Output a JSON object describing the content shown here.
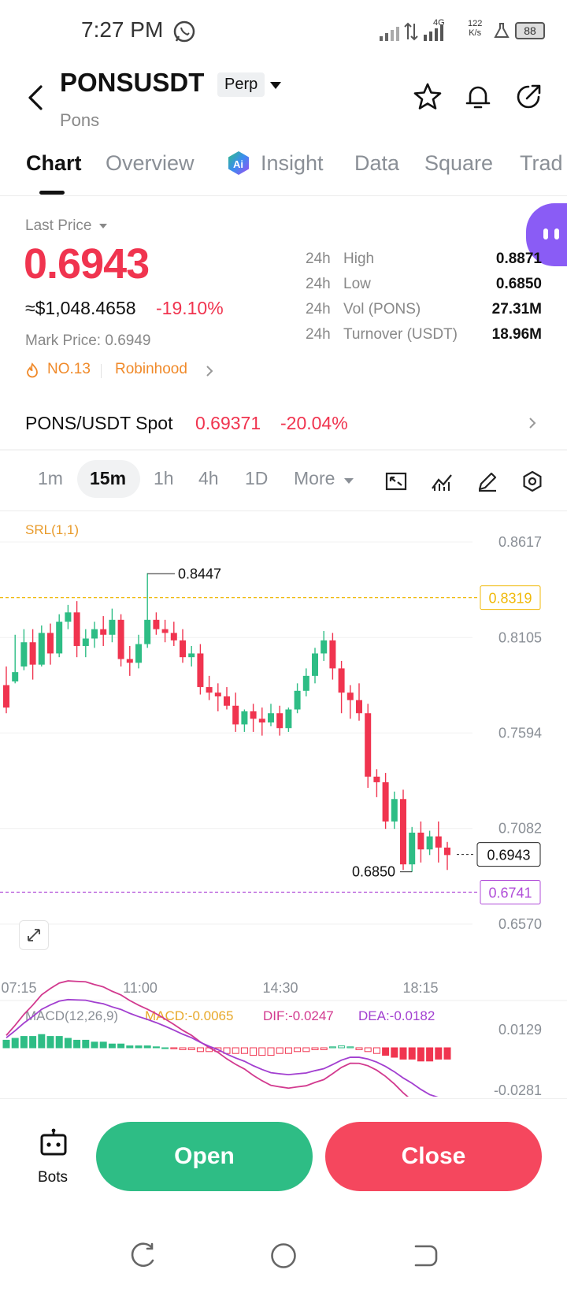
{
  "status_bar": {
    "time": "7:27 PM",
    "network": "4G",
    "speed_value": "122",
    "speed_unit": "K/s",
    "battery": "88"
  },
  "header": {
    "symbol": "PONSUSDT",
    "contract_type": "Perp",
    "base_name": "Pons"
  },
  "tabs": [
    {
      "label": "Chart",
      "active": true
    },
    {
      "label": "Overview"
    },
    {
      "label": "Insight"
    },
    {
      "label": "Data"
    },
    {
      "label": "Square"
    },
    {
      "label": "Trad"
    }
  ],
  "price": {
    "label": "Last Price",
    "last": "0.6943",
    "usd": "≈$1,048.4658",
    "change_pct": "-19.10%",
    "mark_price": "Mark Price: 0.6949",
    "rank": "NO.13",
    "tag": "Robinhood"
  },
  "stats": [
    {
      "period": "24h",
      "label": "High",
      "value": "0.8871"
    },
    {
      "period": "24h",
      "label": "Low",
      "value": "0.6850"
    },
    {
      "period": "24h",
      "label": "Vol (PONS)",
      "value": "27.31M"
    },
    {
      "period": "24h",
      "label": "Turnover (USDT)",
      "value": "18.96M"
    }
  ],
  "spot": {
    "label": "PONS/USDT Spot",
    "price": "0.69371",
    "change": "-20.04%"
  },
  "timeframes": {
    "options": [
      "1m",
      "15m",
      "1h",
      "4h",
      "1D",
      "More"
    ],
    "selected": "15m"
  },
  "chart_data": {
    "type": "candlestick",
    "indicator": "SRL(1,1)",
    "y_ticks": [
      "0.8617",
      "0.8105",
      "0.7594",
      "0.7082",
      "0.6570"
    ],
    "ylim": [
      0.657,
      0.8617
    ],
    "x_ticks": [
      "07:15",
      "11:00",
      "14:30",
      "18:15"
    ],
    "high_marker": "0.8447",
    "low_marker": "0.6850",
    "srl_upper": "0.8319",
    "srl_lower": "0.6741",
    "current_price": "0.6943",
    "candles": [
      [
        0.785,
        0.795,
        0.773,
        0.77
      ],
      [
        0.787,
        0.812,
        0.792,
        0.786
      ],
      [
        0.795,
        0.815,
        0.808,
        0.793
      ],
      [
        0.808,
        0.815,
        0.796,
        0.788
      ],
      [
        0.796,
        0.817,
        0.813,
        0.795
      ],
      [
        0.813,
        0.818,
        0.802,
        0.796
      ],
      [
        0.802,
        0.823,
        0.819,
        0.8
      ],
      [
        0.819,
        0.828,
        0.824,
        0.815
      ],
      [
        0.824,
        0.83,
        0.806,
        0.8
      ],
      [
        0.806,
        0.815,
        0.81,
        0.8
      ],
      [
        0.81,
        0.819,
        0.815,
        0.805
      ],
      [
        0.815,
        0.822,
        0.812,
        0.806
      ],
      [
        0.812,
        0.826,
        0.82,
        0.808
      ],
      [
        0.82,
        0.823,
        0.799,
        0.795
      ],
      [
        0.799,
        0.806,
        0.797,
        0.79
      ],
      [
        0.797,
        0.812,
        0.807,
        0.794
      ],
      [
        0.807,
        0.845,
        0.82,
        0.805
      ],
      [
        0.82,
        0.824,
        0.815,
        0.812
      ],
      [
        0.815,
        0.82,
        0.813,
        0.808
      ],
      [
        0.813,
        0.819,
        0.809,
        0.806
      ],
      [
        0.809,
        0.815,
        0.8,
        0.797
      ],
      [
        0.8,
        0.806,
        0.802,
        0.795
      ],
      [
        0.802,
        0.807,
        0.784,
        0.78
      ],
      [
        0.784,
        0.79,
        0.781,
        0.777
      ],
      [
        0.781,
        0.786,
        0.779,
        0.771
      ],
      [
        0.779,
        0.784,
        0.774,
        0.772
      ],
      [
        0.774,
        0.781,
        0.764,
        0.76
      ],
      [
        0.764,
        0.772,
        0.771,
        0.76
      ],
      [
        0.771,
        0.775,
        0.767,
        0.76
      ],
      [
        0.767,
        0.773,
        0.765,
        0.758
      ],
      [
        0.765,
        0.775,
        0.77,
        0.763
      ],
      [
        0.77,
        0.774,
        0.762,
        0.758
      ],
      [
        0.762,
        0.773,
        0.772,
        0.76
      ],
      [
        0.772,
        0.786,
        0.782,
        0.77
      ],
      [
        0.782,
        0.794,
        0.79,
        0.779
      ],
      [
        0.79,
        0.805,
        0.802,
        0.786
      ],
      [
        0.802,
        0.814,
        0.809,
        0.798
      ],
      [
        0.809,
        0.813,
        0.794,
        0.788
      ],
      [
        0.794,
        0.798,
        0.781,
        0.77
      ],
      [
        0.781,
        0.785,
        0.777,
        0.767
      ],
      [
        0.777,
        0.786,
        0.77,
        0.766
      ],
      [
        0.77,
        0.775,
        0.736,
        0.73
      ],
      [
        0.736,
        0.74,
        0.733,
        0.725
      ],
      [
        0.733,
        0.738,
        0.712,
        0.708
      ],
      [
        0.712,
        0.728,
        0.724,
        0.708
      ],
      [
        0.724,
        0.729,
        0.689,
        0.686
      ],
      [
        0.689,
        0.709,
        0.706,
        0.685
      ],
      [
        0.706,
        0.712,
        0.697,
        0.69
      ],
      [
        0.697,
        0.707,
        0.704,
        0.694
      ],
      [
        0.704,
        0.712,
        0.698,
        0.69
      ],
      [
        0.698,
        0.701,
        0.694,
        0.686
      ]
    ]
  },
  "macd": {
    "title": "MACD(12,26,9)",
    "macd": "MACD:-0.0065",
    "dif": "DIF:-0.0247",
    "dea": "DEA:-0.0182",
    "y_top": "0.0129",
    "y_bottom": "-0.0281",
    "histogram": [
      0.004,
      0.005,
      0.006,
      0.006,
      0.007,
      0.006,
      0.006,
      0.005,
      0.004,
      0.004,
      0.003,
      0.003,
      0.002,
      0.002,
      0.001,
      0.001,
      0.001,
      0.0005,
      0,
      -0.0005,
      -0.001,
      -0.001,
      -0.002,
      -0.002,
      -0.002,
      -0.003,
      -0.003,
      -0.003,
      -0.004,
      -0.004,
      -0.004,
      -0.003,
      -0.003,
      -0.002,
      -0.002,
      -0.001,
      -0.001,
      0.0005,
      0.001,
      0.0005,
      -0.001,
      -0.002,
      -0.003,
      -0.004,
      -0.005,
      -0.006,
      -0.006,
      -0.007,
      -0.007,
      -0.006,
      -0.006
    ]
  },
  "colors": {
    "up": "#2ebd85",
    "down": "#f0344f",
    "srl_upper": "#f0b90b",
    "srl_lower": "#b04cd8",
    "dif": "#d23a8f",
    "dea": "#a23fd0"
  },
  "bottom": {
    "bots_label": "Bots",
    "open_label": "Open",
    "close_label": "Close"
  }
}
